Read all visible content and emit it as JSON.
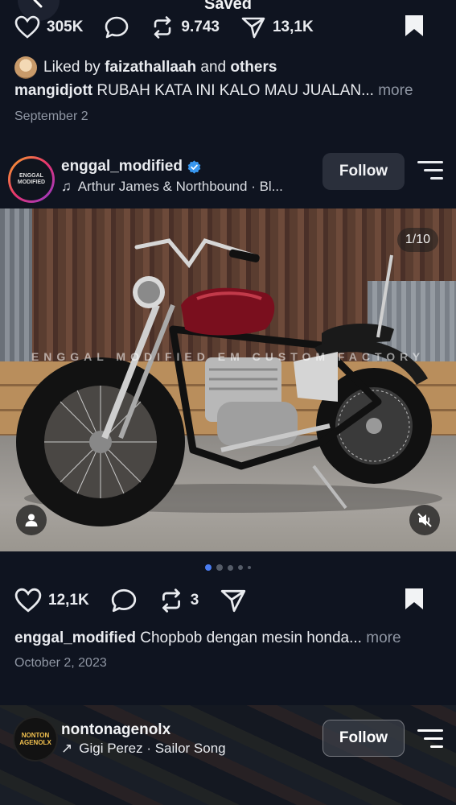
{
  "header": {
    "title": "Saved"
  },
  "prev_post": {
    "likes": "305K",
    "reposts": "9.743",
    "shares": "13,1K",
    "liked_by_prefix": "Liked by",
    "liked_by_user": "faizathallaah",
    "liked_by_and": "and",
    "liked_by_others": "others",
    "caption_user": "mangidjott",
    "caption_text": "RUBAH KATA INI KALO MAU JUALAN...",
    "more_label": "more",
    "date": "September 2"
  },
  "post": {
    "username": "enggal_modified",
    "music": "Arthur James & Northbound · Bl...",
    "follow_label": "Follow",
    "image_counter": "1/10",
    "watermark": "ENGGAL MODIFIED EM CUSTOM FACTORY",
    "avatar_text": "ENGGAL MODIFIED",
    "likes": "12,1K",
    "reposts": "3",
    "caption_user": "enggal_modified",
    "caption_text": "Chopbob dengan mesin honda...",
    "more_label": "more",
    "date": "October 2, 2023",
    "carousel_dots": 5,
    "active_dot": 0
  },
  "next_post": {
    "username": "nontonagenolx",
    "music": "Gigi Perez · Sailor Song",
    "follow_label": "Follow",
    "avatar_text": "NONTON AGENOLX"
  },
  "colors": {
    "background": "#0f1420",
    "verified": "#3897f0",
    "active_dot": "#4a7cf0",
    "bike_tank": "#7a0f1e"
  }
}
